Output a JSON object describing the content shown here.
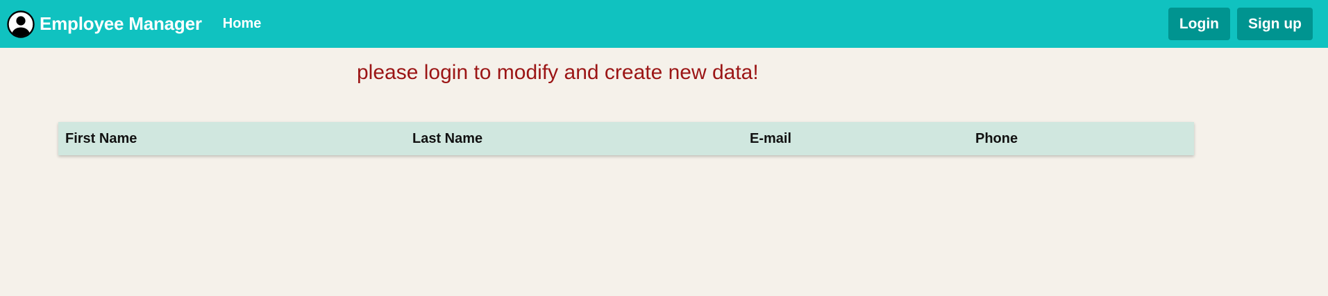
{
  "navbar": {
    "brand_icon": "user-circle-icon",
    "brand_text": "Employee Manager",
    "home_label": "Home",
    "login_label": "Login",
    "signup_label": "Sign up",
    "bg_color": "#10c2c0",
    "button_color": "#009490"
  },
  "main": {
    "notice": "please login to modify and create new data!",
    "notice_color": "#9b1515"
  },
  "table": {
    "headers": [
      "First Name",
      "Last Name",
      "E-mail",
      "Phone"
    ],
    "header_bg": "#d0e7df",
    "rows": []
  }
}
